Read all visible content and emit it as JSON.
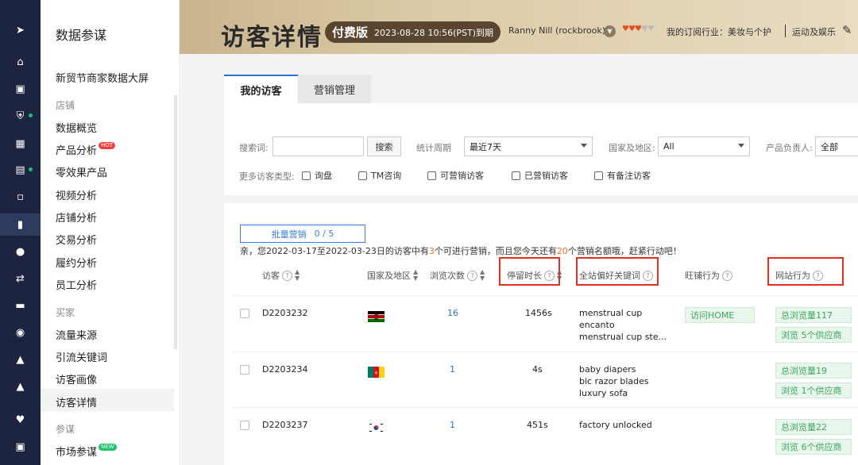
{
  "rail": {
    "icons": [
      "send-icon",
      "home-icon",
      "store-icon",
      "shield-icon",
      "apps-icon",
      "calendar-icon",
      "chat-icon",
      "chart-icon",
      "users-icon",
      "share-icon",
      "clipboard-icon",
      "globe-icon",
      "hat-icon",
      "bank-icon",
      "heart-icon",
      "briefcase-icon"
    ]
  },
  "nav": {
    "title": "数据参谋",
    "top_item": "新贸节商家数据大屏",
    "section_store": "店铺",
    "store_items": [
      "数据概览",
      "产品分析",
      "零效果产品",
      "视频分析",
      "店铺分析",
      "交易分析",
      "履约分析",
      "员工分析"
    ],
    "hot_badge": "HOT",
    "section_buyer": "买家",
    "buyer_items": [
      "流量来源",
      "引流关键词",
      "访客画像",
      "访客详情"
    ],
    "section_market": "参谋",
    "market_items": [
      "市场参谋"
    ],
    "new_badge": "NEW"
  },
  "header": {
    "title": "访客详情",
    "paid_label": "付费版",
    "expiry": "2023-08-28 10:56(PST)到期",
    "user": "Ranny Nill (rockbrook)",
    "industry_label": "我的订阅行业：美妆与个护",
    "industry_other": "运动及娱乐"
  },
  "tabs": {
    "my_visitors": "我的访客",
    "marketing": "营销管理"
  },
  "filters": {
    "search_label": "搜索词:",
    "search_value": "",
    "search_button": "搜索",
    "period_label": "统计周期",
    "period_value": "最近7天",
    "region_label": "国家及地区:",
    "region_value": "All",
    "owner_label": "产品负责人:",
    "owner_value": "全部",
    "more_types_label": "更多访客类型:",
    "types": [
      "询盘",
      "TM咨询",
      "可营销访客",
      "已营销访客",
      "有备注访客"
    ]
  },
  "notice": {
    "part1": "亲，您2022-03-17至2022-03-23日的访客中有",
    "count1": "3",
    "part2": "个可进行营销，而且您今天还有",
    "count2": "20",
    "part3": "个营销名额哦，赶紧行动吧！"
  },
  "bulk": {
    "label": "批量营销",
    "count": "0 / 5"
  },
  "table": {
    "headers": {
      "visitor": "访客",
      "region": "国家及地区",
      "views": "浏览次数",
      "stay": "停留时长",
      "keywords": "全站偏好关键词",
      "store_behavior": "旺铺行为",
      "site_behavior": "网站行为"
    },
    "rows": [
      {
        "id": "D2203232",
        "country": "Kenya",
        "views": "16",
        "stay": "1456s",
        "keywords": [
          "menstrual cup",
          "encanto",
          "menstrual cup ste..."
        ],
        "store_tag": "访问HOME",
        "site_tags": [
          "总浏览量117",
          "浏览 5个供应商"
        ]
      },
      {
        "id": "D2203234",
        "country": "Cameroon",
        "views": "1",
        "stay": "4s",
        "keywords": [
          "baby diapers",
          "bic razor blades",
          "luxury sofa"
        ],
        "store_tag": "",
        "site_tags": [
          "总浏览量19",
          "浏览 1个供应商"
        ]
      },
      {
        "id": "D2203237",
        "country": "South Korea",
        "views": "1",
        "stay": "451s",
        "keywords": [
          "factory unlocked"
        ],
        "store_tag": "",
        "site_tags": [
          "总浏览量22",
          "浏览 6个供应商"
        ]
      }
    ]
  },
  "colors": {
    "accent": "#2e6fd6",
    "highlight_box": "#e03020",
    "rail_bg": "#1c2440",
    "tag_green": "#3aa760"
  }
}
